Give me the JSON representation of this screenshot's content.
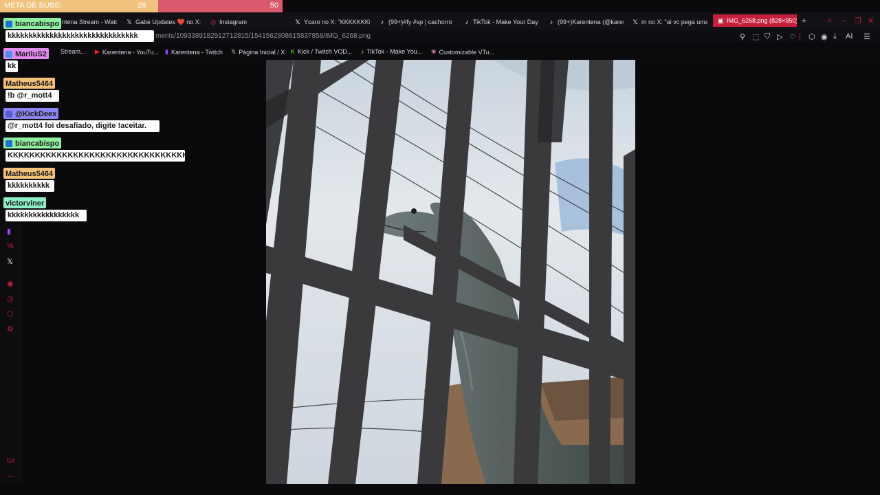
{
  "goal": {
    "title": "META DE SUBS!",
    "current": "28",
    "max": "50",
    "fraction": 0.56,
    "fill_color": "#f0c27d",
    "bar_color": "#d85a6c"
  },
  "tabs": [
    {
      "label": "ntena Stream - Watc",
      "icon": "stream-icon"
    },
    {
      "label": "Gabe Updates ❤️ no X: \"",
      "icon": "x-icon"
    },
    {
      "label": "Instagram",
      "icon": "instagram-icon"
    },
    {
      "label": "Ycaro no X: \"KKKKKKKK",
      "icon": "x-icon"
    },
    {
      "label": "(99+)#fy #sp | cachorro",
      "icon": "tiktok-icon"
    },
    {
      "label": "TikTok - Make Your Day",
      "icon": "tiktok-icon"
    },
    {
      "label": "(99+)Karentena (@karen",
      "icon": "tiktok-icon"
    },
    {
      "label": "m no X: \"ai vc pega uma",
      "icon": "x-icon"
    },
    {
      "label": "IMG_6268.png (828×950)",
      "icon": "image-icon",
      "active": true
    }
  ],
  "address": {
    "url": "ments/1093389182912712815/1541562808615837858/IMG_6268.png"
  },
  "bookmarks": [
    {
      "label": "Stream...",
      "icon": "stream-icon"
    },
    {
      "label": "Karentena - YouTu...",
      "icon": "youtube-icon"
    },
    {
      "label": "Karentena - Twitch",
      "icon": "twitch-icon"
    },
    {
      "label": "Página Inicial / X",
      "icon": "x-icon"
    },
    {
      "label": "Kick / Twitch VOD...",
      "icon": "kick-icon"
    },
    {
      "label": "TikTok - Make You...",
      "icon": "tiktok-icon"
    },
    {
      "label": "Customizable VTu...",
      "icon": "vtuber-icon"
    }
  ],
  "toolbar": {
    "ai_label": "AI"
  },
  "sidebar": {
    "bottom_label": "GX"
  },
  "chat": [
    {
      "user": "biancabispo",
      "color": "#8ff0a0",
      "message": "kkkkkkkkkkkkkkkkkkkkkkkkkkkkkkk"
    },
    {
      "user": "MariluS2",
      "color": "#e38cf0",
      "message": "kk"
    },
    {
      "user": "Matheus5464",
      "color": "#f5c27a",
      "message": "!b @r_mott4"
    },
    {
      "user": "@KickDeex",
      "color": "#8a86f5",
      "message": "@r_mott4 foi desafiado, digite !aceitar."
    },
    {
      "user": "biancabispo",
      "color": "#8ff0a0",
      "message": "KKKKKKKKKKKKKKKKKKKKKKKKKKKKKKKKKKKKKKKKK"
    },
    {
      "user": "Matheus5464",
      "color": "#f5c27a",
      "message": "kkkkkkkkkk"
    },
    {
      "user": "victorviner",
      "color": "#8ff0c8",
      "message": "kkkkkkkkkkkkkkkkk"
    }
  ]
}
